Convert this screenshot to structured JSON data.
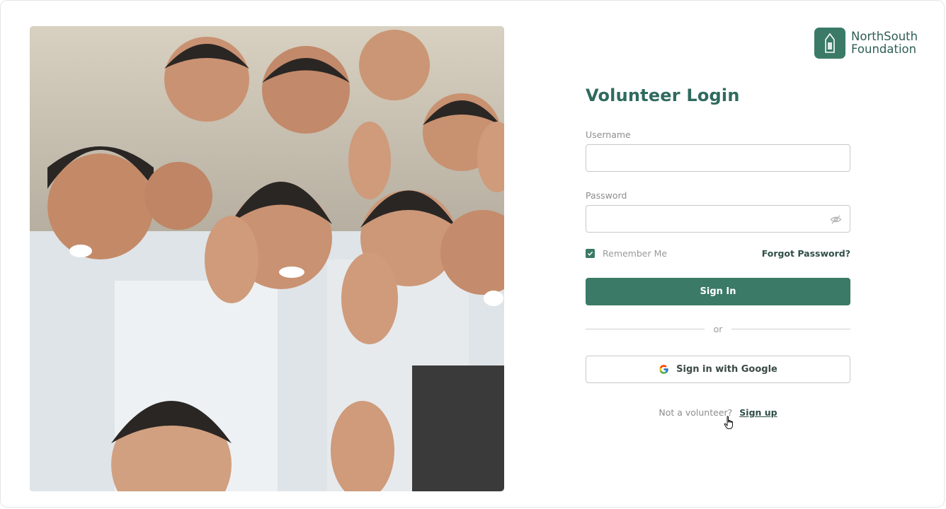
{
  "brand": {
    "line1": "NorthSouth",
    "line2": "Foundation",
    "color": "#3a7a66"
  },
  "login": {
    "title": "Volunteer Login",
    "username_label": "Username",
    "username_value": "",
    "password_label": "Password",
    "password_value": "",
    "password_toggle_icon": "eye-off-icon",
    "remember_label": "Remember Me",
    "remember_checked": true,
    "forgot_label": "Forgot Password?",
    "sign_in_label": "Sign In",
    "divider_label": "or",
    "google_label": "Sign in with Google",
    "signup_prompt": "Not a volunteer?",
    "signup_link": "Sign up"
  },
  "hero": {
    "icon": "photo-children-waving",
    "colors": {
      "shirt": "#e8ecef",
      "skin": "#c99272",
      "hair": "#2a2624"
    }
  }
}
